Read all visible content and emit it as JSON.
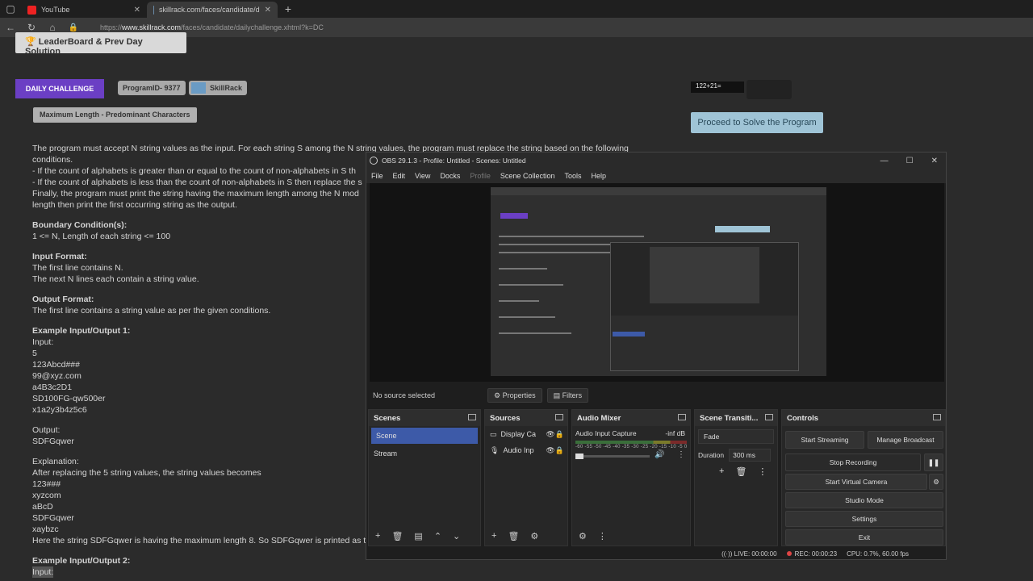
{
  "browser": {
    "tabs": [
      {
        "label": "YouTube"
      },
      {
        "label": "skillrack.com/faces/candidate/d"
      }
    ],
    "url_prefix": "https://",
    "url_domain": "www.skillrack.com",
    "url_path": "/faces/candidate/dailychallenge.xhtml?k=DC"
  },
  "page": {
    "leaderboard_label": "LeaderBoard & Prev Day Solution",
    "daily_challenge": "DAILY CHALLENGE",
    "program_id": "ProgramID- 9377",
    "brand": "SkillRack",
    "problem_title": "Maximum Length - Predominant Characters",
    "captcha": "122+21=",
    "proceed": "Proceed to Solve the Program",
    "lines": [
      "The program must accept N string values as the input. For each string S among the N string values, the program must replace the string based on the following",
      "conditions.",
      "- If the count of alphabets is greater than or equal to the count of non-alphabets in S th",
      "- If the count of alphabets is less than the count of non-alphabets in S then replace the s",
      "Finally, the program must print the string having the maximum length among the N mod",
      "length then print the first occurring string as the output."
    ],
    "boundary_h": "Boundary Condition(s):",
    "boundary": "1 <= N, Length of each string <= 100",
    "input_h": "Input Format:",
    "input1": "The first line contains N.",
    "input2": "The next N lines each contain a string value.",
    "output_h": "Output Format:",
    "output1": "The first line contains a string value as per the given conditions.",
    "ex1_h": "Example Input/Output 1:",
    "ex1_input_label": "Input:",
    "ex1_inputs": [
      "5",
      "123Abcd###",
      "99@xyz.com",
      "a4B3c2D1",
      "SD100FG-qw500er",
      "x1a2y3b4z5c6"
    ],
    "ex1_output_label": "Output:",
    "ex1_output": "SDFGqwer",
    "expl_label": "Explanation:",
    "expl_line": "After replacing the 5 string values, the string values becomes",
    "expl_values": [
      "123###",
      "xyzcom",
      "aBcD",
      "SDFGqwer",
      "xaybzc"
    ],
    "expl_final": "Here the string SDFGqwer is having the maximum length 8. So SDFGqwer is printed as t",
    "ex2_h": "Example Input/Output 2:",
    "ex2_input_label": "Input:"
  },
  "obs": {
    "title": "OBS 29.1.3 - Profile: Untitled - Scenes: Untitled",
    "menu": [
      "File",
      "Edit",
      "View",
      "Docks",
      "Profile",
      "Scene Collection",
      "Tools",
      "Help"
    ],
    "no_source": "No source selected",
    "properties": "Properties",
    "filters": "Filters",
    "scenes_title": "Scenes",
    "scenes": [
      "Scene",
      "Stream"
    ],
    "sources_title": "Sources",
    "sources": [
      "Display Ca",
      "Audio Inp"
    ],
    "mixer_title": "Audio Mixer",
    "mixer_track": "Audio Input Capture",
    "mixer_level": "-inf dB",
    "mixer_ticks": "-60 -55 -50 -45 -40 -35 -30 -25 -20 -15 -10 -5 0",
    "trans_title": "Scene Transiti...",
    "trans_value": "Fade",
    "duration_label": "Duration",
    "duration_value": "300 ms",
    "controls_title": "Controls",
    "start_streaming": "Start Streaming",
    "manage_broadcast": "Manage Broadcast",
    "stop_recording": "Stop Recording",
    "start_virtual_camera": "Start Virtual Camera",
    "studio_mode": "Studio Mode",
    "settings": "Settings",
    "exit": "Exit",
    "status_live": "LIVE: 00:00:00",
    "status_rec": "REC: 00:00:23",
    "status_cpu": "CPU: 0.7%, 60.00 fps"
  },
  "colors": {
    "accent": "#6b3fc4",
    "selection": "#3d5aa8"
  }
}
